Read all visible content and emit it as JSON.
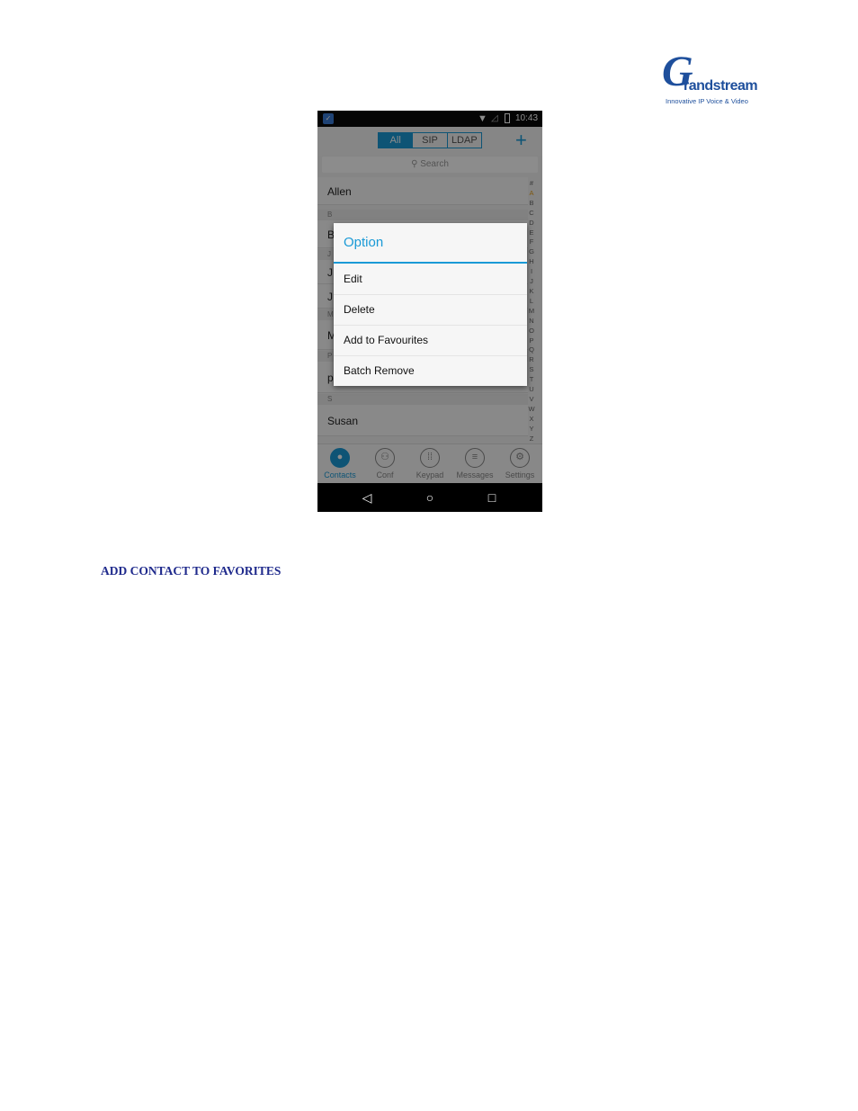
{
  "logo": {
    "initial": "G",
    "name": "randstream",
    "tagline": "Innovative IP Voice & Video"
  },
  "phone": {
    "status_bar": {
      "time": "10:43"
    },
    "filter_tabs": [
      "All",
      "SIP",
      "LDAP"
    ],
    "active_filter": "All",
    "add_label": "+",
    "search_placeholder": "Search",
    "contacts": [
      {
        "section": "",
        "name": "Allen"
      },
      {
        "section": "B",
        "name": "B"
      },
      {
        "section": "J",
        "name": "J"
      },
      {
        "section": "",
        "name": "J"
      },
      {
        "section": "M",
        "name": "M"
      },
      {
        "section": "P",
        "name": "papa"
      },
      {
        "section": "S",
        "name": "Susan"
      }
    ],
    "alpha_index": [
      "#",
      "A",
      "B",
      "C",
      "D",
      "E",
      "F",
      "G",
      "H",
      "I",
      "J",
      "K",
      "L",
      "M",
      "N",
      "O",
      "P",
      "Q",
      "R",
      "S",
      "T",
      "U",
      "V",
      "W",
      "X",
      "Y",
      "Z"
    ],
    "bottom_tabs": [
      {
        "label": "Contacts",
        "icon": "person-icon",
        "active": true
      },
      {
        "label": "Conf",
        "icon": "conference-icon",
        "active": false
      },
      {
        "label": "Keypad",
        "icon": "keypad-icon",
        "active": false
      },
      {
        "label": "Messages",
        "icon": "message-icon",
        "active": false
      },
      {
        "label": "Settings",
        "icon": "gear-icon",
        "active": false
      }
    ],
    "nav": {
      "back": "◁",
      "home": "○",
      "recent": "□"
    },
    "dialog": {
      "title": "Option",
      "items": [
        "Edit",
        "Delete",
        "Add to Favourites",
        "Batch Remove"
      ]
    }
  },
  "section_heading": "ADD CONTACT TO FAVORITES",
  "colors": {
    "accent": "#1a9ad6",
    "heading": "#1f2a8c",
    "logo": "#1e4f9c"
  }
}
